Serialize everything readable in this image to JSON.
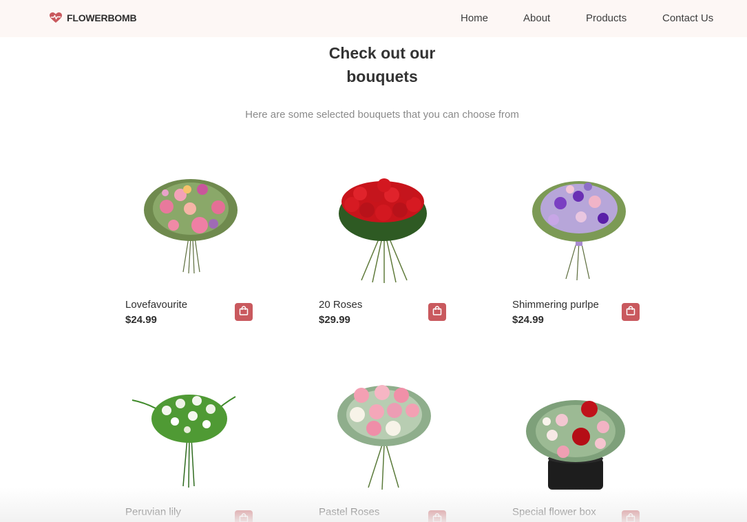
{
  "brand": {
    "name": "FLOWERBOMB",
    "icon": "heart-pulse-icon",
    "color": "#c9595e"
  },
  "nav": {
    "items": [
      {
        "label": "Home"
      },
      {
        "label": "About"
      },
      {
        "label": "Products"
      },
      {
        "label": "Contact Us"
      }
    ]
  },
  "section": {
    "title_line1": "Check out our",
    "title_line2": "bouquets",
    "subtitle": "Here are some selected bouquets that you can choose from"
  },
  "products": [
    {
      "name": "Lovefavourite",
      "price": "$24.99",
      "image": "mixed-pink-bouquet"
    },
    {
      "name": "20 Roses",
      "price": "$29.99",
      "image": "red-roses-bouquet"
    },
    {
      "name": "Shimmering purlpe",
      "price": "$24.99",
      "image": "purple-bouquet"
    },
    {
      "name": "Peruvian lily",
      "price": "",
      "image": "white-lily-bouquet"
    },
    {
      "name": "Pastel Roses",
      "price": "",
      "image": "pastel-roses-bouquet"
    },
    {
      "name": "Special flower box",
      "price": "",
      "image": "flower-box"
    }
  ],
  "colors": {
    "accent": "#c9595e",
    "nav_bg": "#fdf7f5",
    "subtitle": "#8a8a8a"
  }
}
